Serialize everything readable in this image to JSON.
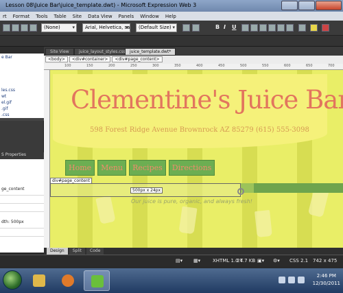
{
  "window": {
    "title": "Lesson 08\\Juice Bar\\juice_template.dwt) - Microsoft Expression Web 3"
  },
  "menu": [
    "rt",
    "Format",
    "Tools",
    "Table",
    "Site",
    "Data View",
    "Panels",
    "Window",
    "Help"
  ],
  "toolbar": {
    "style_select": "(None)",
    "font_select": "Arial, Helvetica, sans-seri",
    "size_select": "(Default Size)",
    "bold": "B",
    "italic": "I",
    "underline": "U"
  },
  "left_panel": {
    "top_items": [
      "e Bar",
      "les.css",
      "wt",
      "el.gif",
      ".gif",
      ".css"
    ],
    "bottom_title": "S Properties",
    "bottom_items": [
      "ge_content",
      "dth: 500px"
    ]
  },
  "doc_tabs": [
    "Site View",
    "juice_layout_styles.css*",
    "juice_template.dwt*"
  ],
  "breadcrumbs": [
    "<body>",
    "<div#container>",
    "<div#page_content>"
  ],
  "ruler_ticks": [
    "100",
    "150",
    "200",
    "250",
    "300",
    "350",
    "400",
    "450",
    "500",
    "550",
    "600",
    "650",
    "700"
  ],
  "page": {
    "site_title": "Clementine's Juice Bar",
    "address": "598 Forest Ridge Avenue Brownrock AZ 85279 (615) 555-3098",
    "nav": [
      "Home",
      "Menu",
      "Recipes",
      "Directions"
    ],
    "div_label": "div#page_content",
    "size_tag": "500px x 24px",
    "tagline": "Our juice is pure, organic, and always fresh!"
  },
  "view_tabs": [
    "Design",
    "Split",
    "Code"
  ],
  "status": {
    "doctype": "XHTML 1.0 T",
    "size": "24.7 KB",
    "css": "CSS 2.1",
    "dimensions": "742 x 475"
  },
  "taskbar": {
    "time": "2:46 PM",
    "date": "12/30/2011"
  }
}
